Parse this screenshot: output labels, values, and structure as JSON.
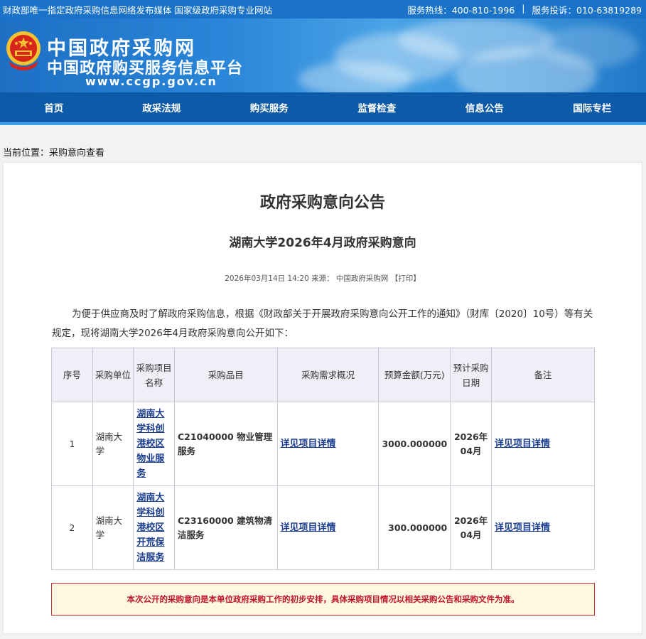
{
  "topbar": {
    "left": "财政部唯一指定政府采购信息网络发布媒体 国家级政府采购专业网站",
    "hotline": "服务热线：400-810-1996",
    "separator": "|",
    "complaint": "服务投诉：010-63819289"
  },
  "header": {
    "site_name": "中国政府采购网",
    "platform_name": "中国政府购买服务信息平台",
    "url": "www.ccgp.gov.cn",
    "emblem_icon": "national-emblem-icon"
  },
  "nav": {
    "items": [
      {
        "label": "首页"
      },
      {
        "label": "政采法规"
      },
      {
        "label": "购买服务"
      },
      {
        "label": "监督检查"
      },
      {
        "label": "信息公告"
      },
      {
        "label": "国际专栏"
      }
    ]
  },
  "breadcrumb": {
    "label": "当前位置：",
    "current": "采购意向查看"
  },
  "article": {
    "title": "政府采购意向公告",
    "subtitle": "湖南大学2026年4月政府采购意向",
    "meta": "2026年03月14日 14:20 来源：  中国政府采购网 【打印】",
    "paragraph": "为便于供应商及时了解政府采购信息，根据《财政部关于开展政府采购意向公开工作的通知》（财库〔2020〕10号）等有关规定，现将湖南大学2026年4月政府采购意向公开如下："
  },
  "table": {
    "headers": {
      "seq": "序号",
      "unit": "采购单位",
      "project": "采购项目名称",
      "item": "采购品目",
      "demand": "采购需求概况",
      "budget": "预算金额(万元)",
      "date": "预计采购日期",
      "note": "备注"
    },
    "rows": [
      {
        "seq": "1",
        "unit": "湖南大学",
        "project": "湖南大学科创港校区物业服务",
        "item": "C21040000 物业管理服务",
        "demand": "详见项目详情",
        "budget": "3000.000000",
        "date": "2026年04月",
        "note": "详见项目详情"
      },
      {
        "seq": "2",
        "unit": "湖南大学",
        "project": "湖南大学科创港校区开荒保洁服务",
        "item": "C23160000 建筑物清洁服务",
        "demand": "详见项目详情",
        "budget": "300.000000",
        "date": "2026年04月",
        "note": "详见项目详情"
      }
    ]
  },
  "notice": "本次公开的采购意向是本单位政府采购工作的初步安排，具体采购项目情况以相关采购公告和采购文件为准。",
  "colors": {
    "topbar": "#1a73c8",
    "nav": "#0d5aa8",
    "notice_text": "#c0142a",
    "notice_bg": "#fff8e0"
  }
}
